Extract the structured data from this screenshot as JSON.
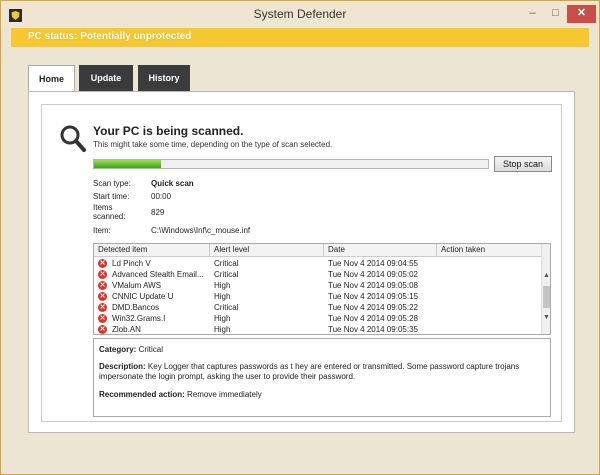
{
  "window": {
    "title": "System Defender",
    "controls": {
      "minimize": "–",
      "maximize": "□",
      "close": "✕"
    }
  },
  "status_bar": {
    "text": "PC status: Potentially unprotected"
  },
  "tabs": [
    {
      "label": "Home",
      "active": true
    },
    {
      "label": "Update",
      "active": false
    },
    {
      "label": "History",
      "active": false
    }
  ],
  "scan": {
    "title": "Your PC is being scanned.",
    "subtitle": "This might take some time, depending on the type of scan selected.",
    "progress_fraction": 0.17,
    "stop_label": "Stop scan",
    "info": {
      "scan_type_label": "Scan type:",
      "scan_type_value": "Quick scan",
      "start_time_label": "Start time:",
      "start_time_value": "00:00",
      "items_scanned_label": "Items scanned:",
      "items_scanned_value": "829",
      "item_label": "Item:",
      "item_value": "C:\\Windows\\Inf\\c_mouse.inf"
    }
  },
  "table": {
    "headers": [
      "Detected item",
      "Alert level",
      "Date",
      "Action taken"
    ],
    "rows": [
      {
        "item": "Ld Pinch V",
        "level": "Critical",
        "date": "Tue Nov 4 2014 09:04:55"
      },
      {
        "item": "Advanced Stealth Email...",
        "level": "Critical",
        "date": "Tue Nov 4 2014 09:05:02"
      },
      {
        "item": "VMalum AWS",
        "level": "High",
        "date": "Tue Nov 4 2014 09:05:08"
      },
      {
        "item": "CNNIC Update U",
        "level": "High",
        "date": "Tue Nov 4 2014 09:05:15"
      },
      {
        "item": "DMD.Bancos",
        "level": "Critical",
        "date": "Tue Nov 4 2014 09:05:22"
      },
      {
        "item": "Win32.Grams.I",
        "level": "High",
        "date": "Tue Nov 4 2014 09:05:28"
      },
      {
        "item": "Zlob.AN",
        "level": "High",
        "date": "Tue Nov 4 2014 09:05:35"
      }
    ]
  },
  "details": {
    "category_label": "Category:",
    "category_value": "Critical",
    "description_label": "Description:",
    "description_value": "Key Logger that captures passwords as t hey are entered or transmitted. Some password capture trojans impersonate the login prompt, asking the user to provide their password.",
    "action_label": "Recommended action:",
    "action_value": "Remove immediately"
  },
  "colors": {
    "status_bar": "#f6c82f",
    "tab_dark": "#3b3b3b",
    "close_button": "#c74f48",
    "progress": "#3ea01a",
    "error_icon": "#d9342b"
  }
}
